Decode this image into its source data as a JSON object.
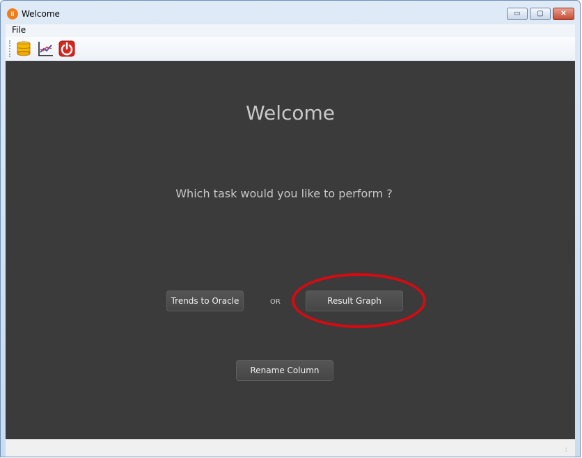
{
  "window": {
    "title": "Welcome",
    "app_icon_text": "ii",
    "controls": {
      "minimize": "▭",
      "maximize": "▢",
      "close": "✕"
    }
  },
  "menubar": {
    "items": [
      {
        "label": "File"
      }
    ]
  },
  "toolbar": {
    "tools": [
      {
        "name": "database-icon"
      },
      {
        "name": "graph-icon"
      },
      {
        "name": "power-icon"
      }
    ]
  },
  "main": {
    "heading": "Welcome",
    "question": "Which task would you like to perform ?",
    "buttons": {
      "trends": "Trends to Oracle",
      "result": "Result Graph",
      "rename": "Rename Column"
    },
    "or_text": "OR"
  },
  "annotation": {
    "color": "#d60b12"
  },
  "statusbar": {
    "grip": "⁞"
  }
}
